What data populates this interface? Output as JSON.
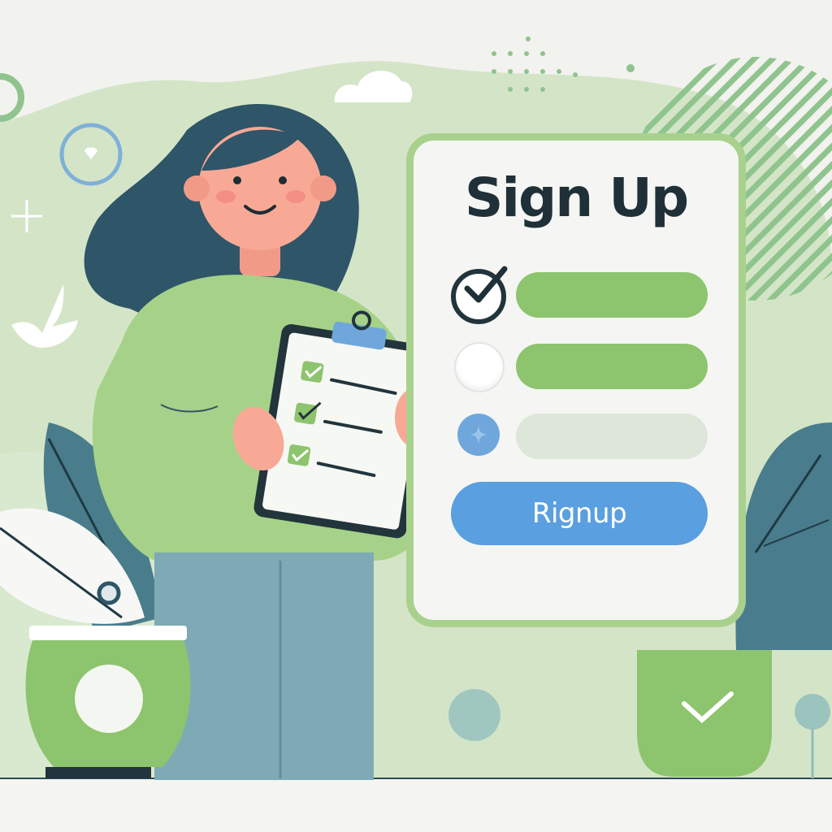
{
  "signup": {
    "title": "Sign Up",
    "fields": [
      {
        "state": "checked",
        "icon": "check-icon"
      },
      {
        "state": "empty",
        "icon": "empty-circle-icon"
      },
      {
        "state": "pending",
        "icon": "sparkle-icon"
      }
    ],
    "button_label": "Rignup"
  },
  "colors": {
    "accent_green": "#8dc46e",
    "card_border": "#a9d18e",
    "button_blue": "#5a9fe0",
    "dark_teal": "#2f5568",
    "background": "#f2f2ef"
  }
}
